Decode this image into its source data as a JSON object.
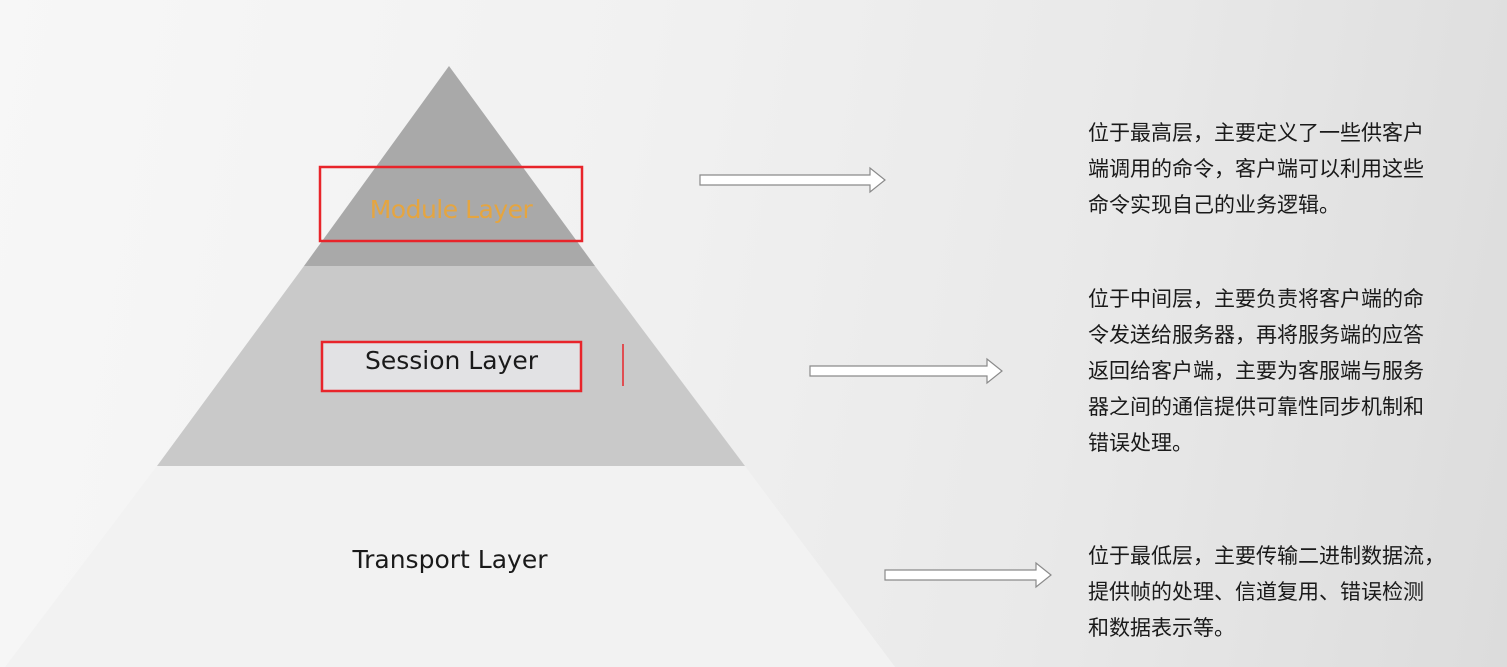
{
  "layers": [
    {
      "id": "module",
      "label": "Module Layer",
      "description": "位于最高层，主要定义了一些供客户\n端调用的命令，客户端可以利用这些\n命令实现自己的业务逻辑。"
    },
    {
      "id": "session",
      "label": "Session Layer",
      "description": "位于中间层，主要负责将客户端的命\n令发送给服务器，再将服务端的应答\n返回给客户端，主要为客服端与服务\n器之间的通信提供可靠性同步机制和\n错误处理。"
    },
    {
      "id": "transport",
      "label": "Transport Layer",
      "description": "位于最低层，主要传输二进制数据流，\n提供帧的处理、信道复用、错误检测\n和数据表示等。"
    }
  ],
  "colors": {
    "top_layer": "#a8a8a8",
    "middle_layer": "#c8c8c8",
    "bottom_layer": "#f0f0f0",
    "highlight_box": "#e8242a",
    "module_text": "#e5a540"
  }
}
